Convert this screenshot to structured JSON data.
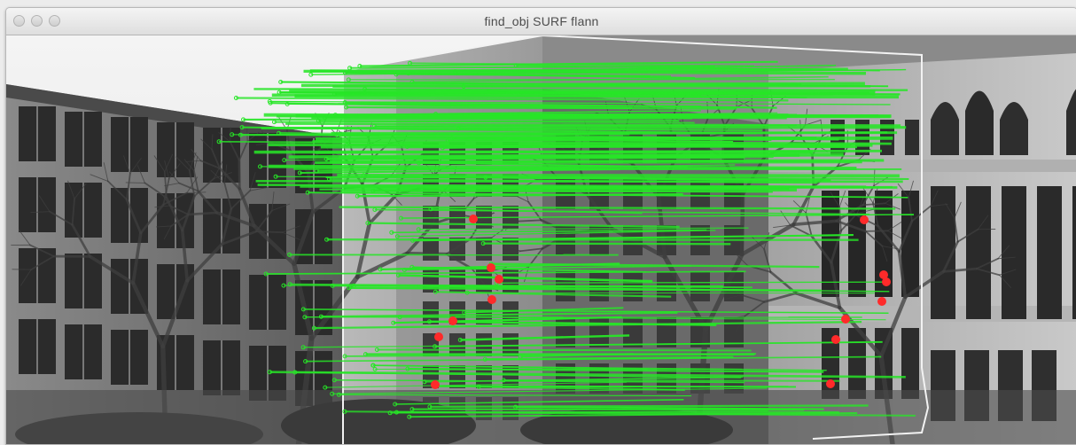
{
  "window": {
    "title": "find_obj SURF flann",
    "buttons": [
      "close",
      "minimize",
      "zoom"
    ]
  },
  "image": {
    "description_icon": "photo-icon",
    "match_color": "#27e627",
    "keypoint_color": "#ff2a2a",
    "object_outline_color": "#f2f2f2"
  }
}
